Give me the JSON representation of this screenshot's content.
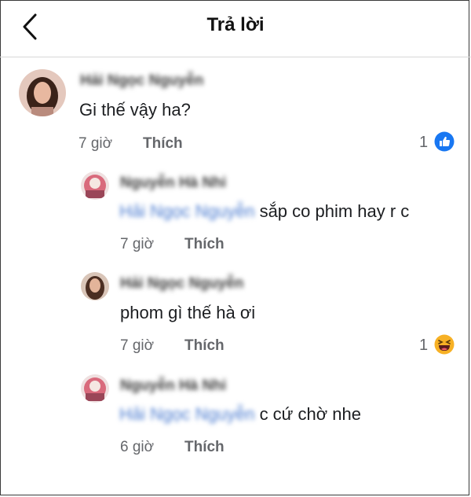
{
  "header": {
    "title": "Trả lời",
    "back_icon": "chevron-left-icon"
  },
  "colors": {
    "like_blue": "#1877f2",
    "haha_yellow": "#f7b125",
    "link_blue": "#4a7bd0"
  },
  "comments": [
    {
      "author": "Hải Ngọc Nguyễn",
      "text": "Gi thế vậy ha?",
      "time": "7 giờ",
      "like_label": "Thích",
      "reaction": {
        "count": "1",
        "icon": "like-reaction-icon"
      }
    },
    {
      "author": "Nguyễn Hà Nhi",
      "mention": "Hải Ngọc Nguyễn",
      "text": "sắp co phim hay r c",
      "time": "7 giờ",
      "like_label": "Thích"
    },
    {
      "author": "Hải Ngọc Nguyễn",
      "text": "phom gì thế hà ơi",
      "time": "7 giờ",
      "like_label": "Thích",
      "reaction": {
        "count": "1",
        "icon": "haha-reaction-icon"
      }
    },
    {
      "author": "Nguyễn Hà Nhi",
      "mention": "Hải Ngọc Nguyễn",
      "text": "c cứ chờ nhe",
      "time": "6 giờ",
      "like_label": "Thích"
    }
  ]
}
